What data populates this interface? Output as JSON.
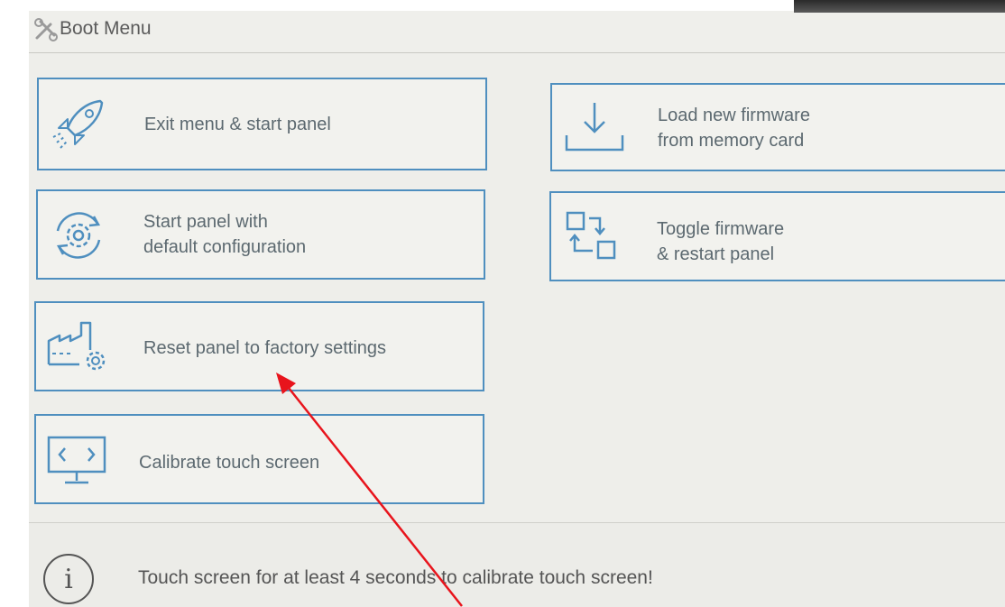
{
  "header": {
    "title": "Boot Menu",
    "icon": "tools-icon"
  },
  "buttons": {
    "exit": {
      "label": "Exit menu & start panel",
      "icon": "rocket-icon"
    },
    "default_config": {
      "line1": "Start panel with",
      "line2": "default configuration",
      "icon": "gear-refresh-icon"
    },
    "factory_reset": {
      "label": "Reset panel to factory settings",
      "icon": "factory-gear-icon"
    },
    "calibrate": {
      "label": "Calibrate touch screen",
      "icon": "monitor-icon"
    },
    "load_firmware": {
      "line1": "Load new firmware",
      "line2": "from memory card",
      "icon": "download-icon"
    },
    "toggle_firmware": {
      "line1": "Toggle firmware",
      "line2": "& restart panel",
      "icon": "swap-icon"
    }
  },
  "footer": {
    "message": "Touch screen for at least 4 seconds to calibrate touch screen!",
    "info_glyph": "i",
    "icon": "info-icon"
  },
  "colors": {
    "accent": "#4f8fbf",
    "background": "#eeeeea",
    "text": "#5c6970",
    "annotation_arrow": "#e8141c"
  }
}
